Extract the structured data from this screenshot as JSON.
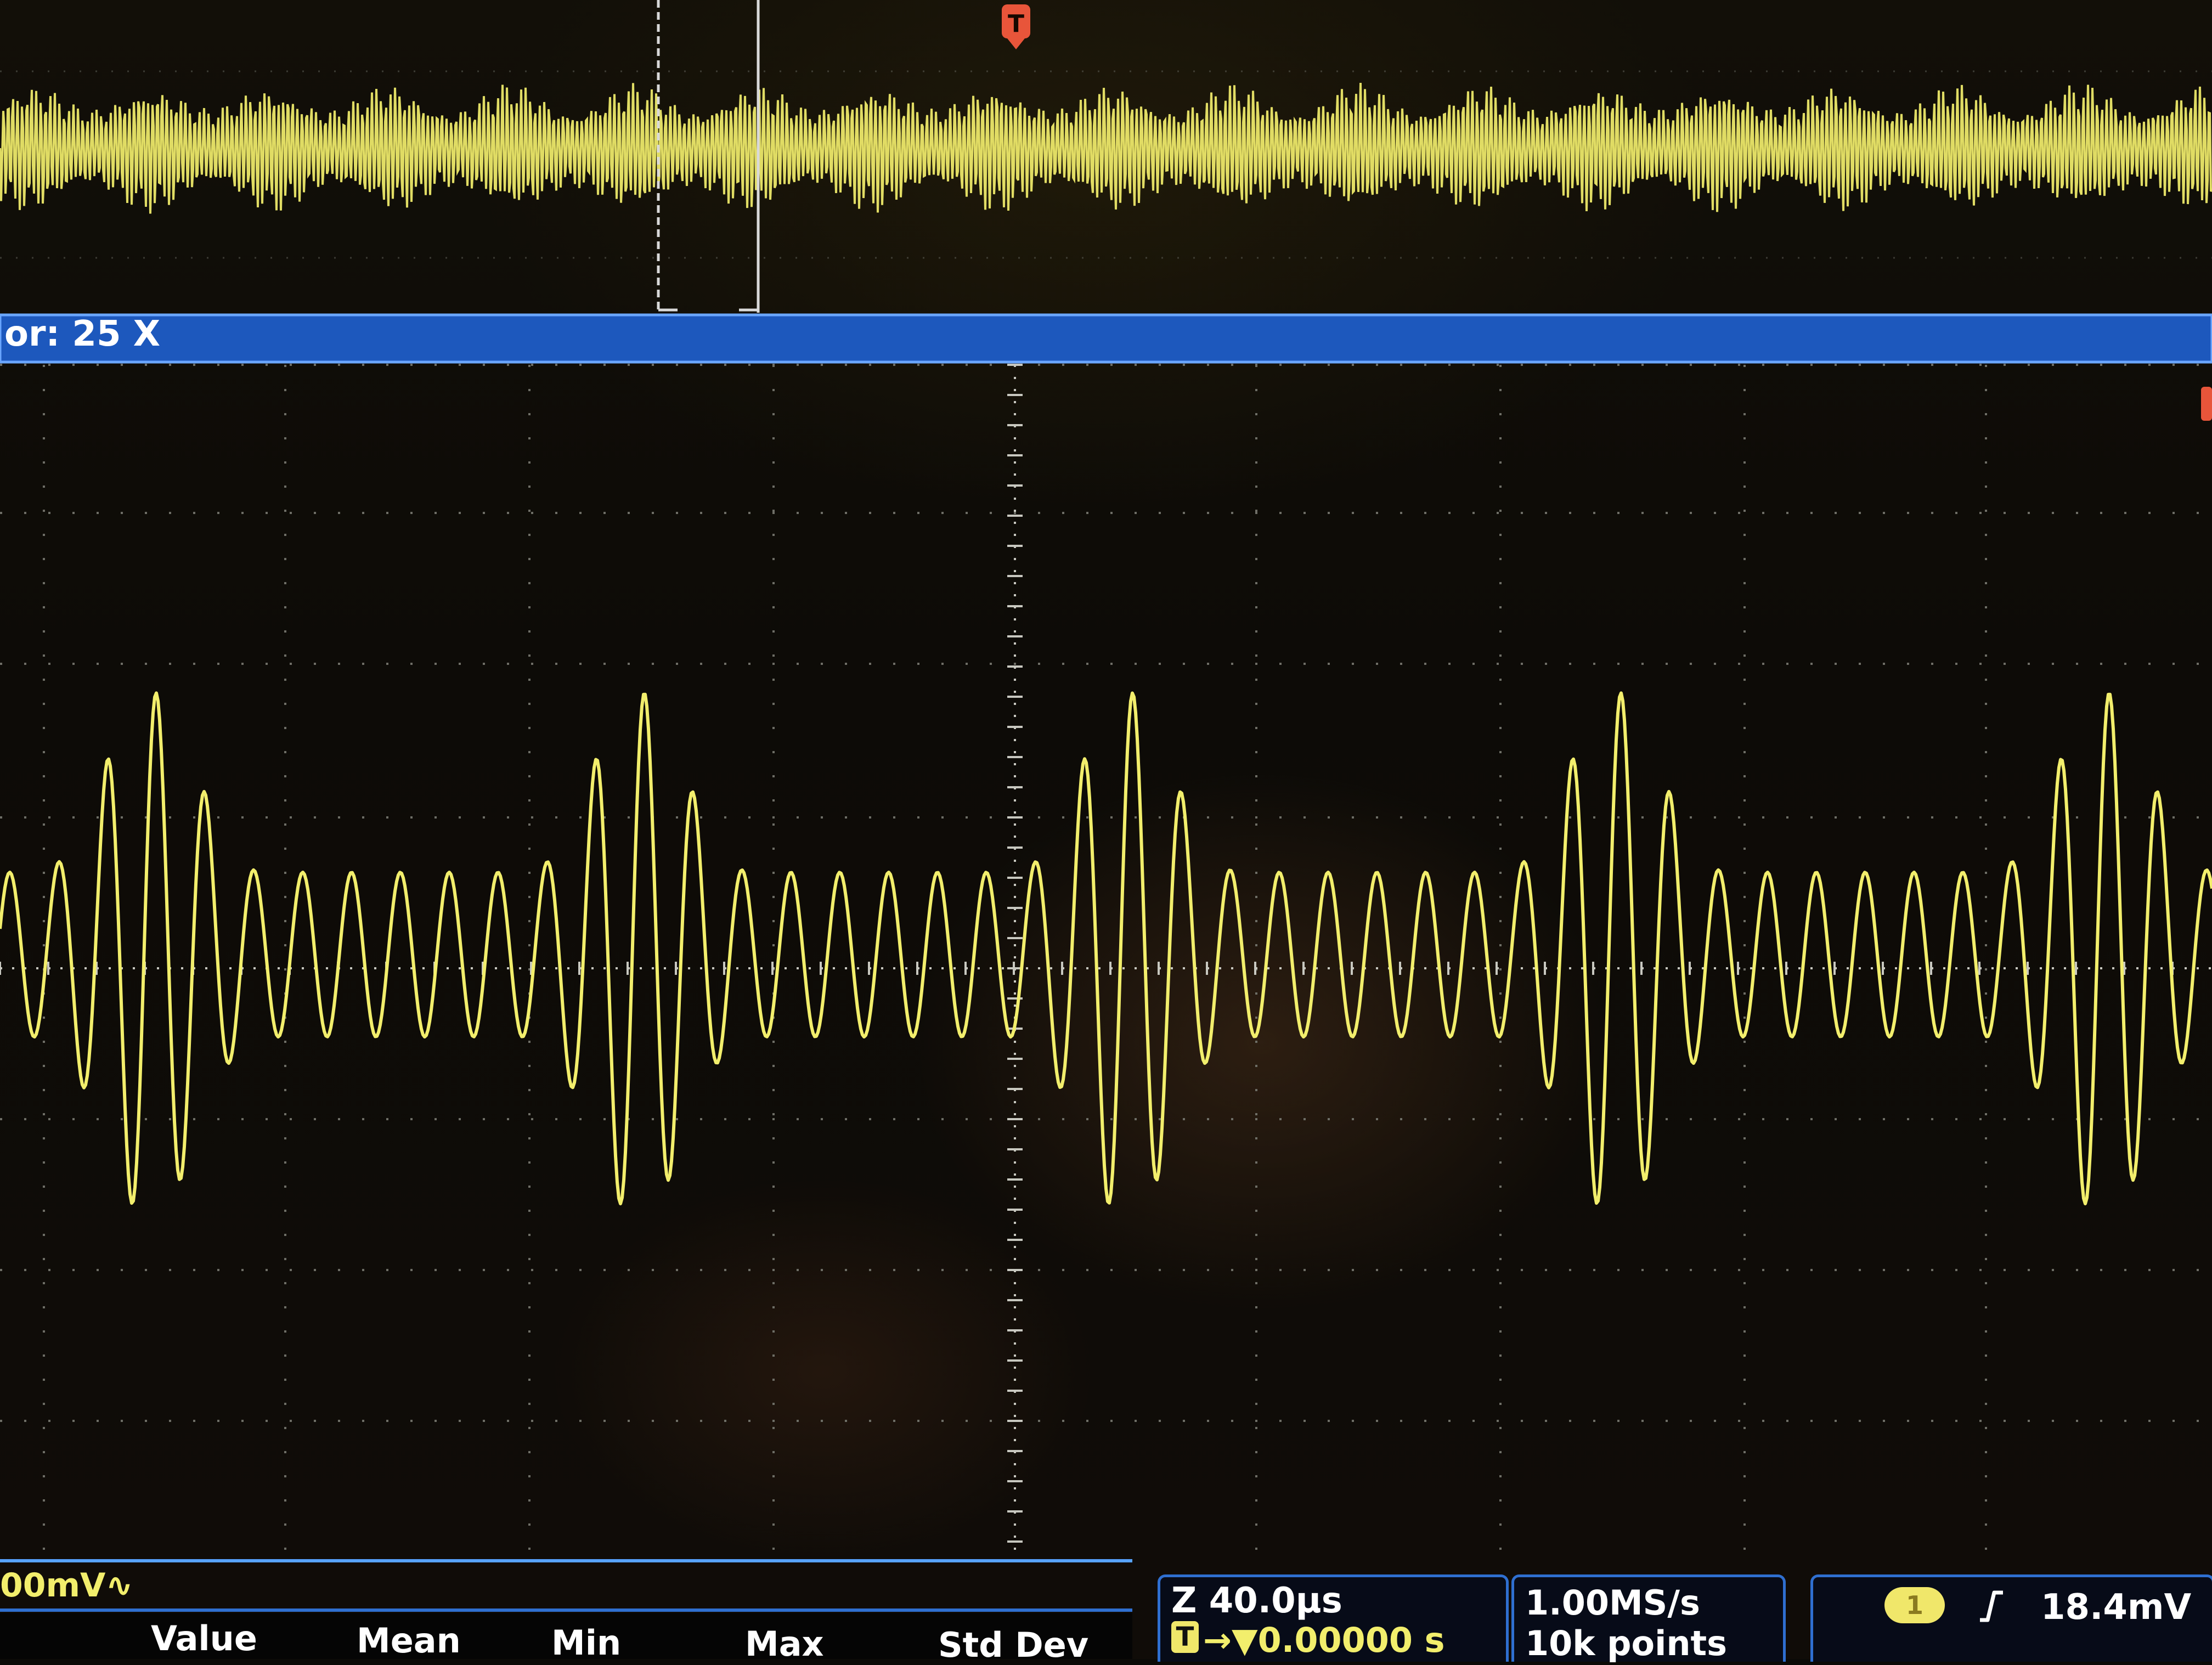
{
  "zoom_bar": {
    "label": "or: 25 X"
  },
  "trigger_marker": "T",
  "channel": {
    "scale_label": "00mV∿",
    "color": "#f2ee6c"
  },
  "measurements": {
    "headers": [
      "Value",
      "Mean",
      "Min",
      "Max",
      "Std Dev"
    ]
  },
  "horizontal": {
    "zoom_scale": "Z 40.0µs",
    "trigger_badge": "T",
    "position": "→▼0.00000 s"
  },
  "acquisition": {
    "sample_rate": "1.00MS/s",
    "record_length": "10k points"
  },
  "trigger": {
    "source": "1",
    "slope_icon": "rising-edge-icon",
    "level": "18.4mV"
  },
  "colors": {
    "trace": "#f2ee6c",
    "zoom_bar": "#2f6fd0",
    "trigger_marker": "#e8553a",
    "badge": "#f0e76a"
  }
}
